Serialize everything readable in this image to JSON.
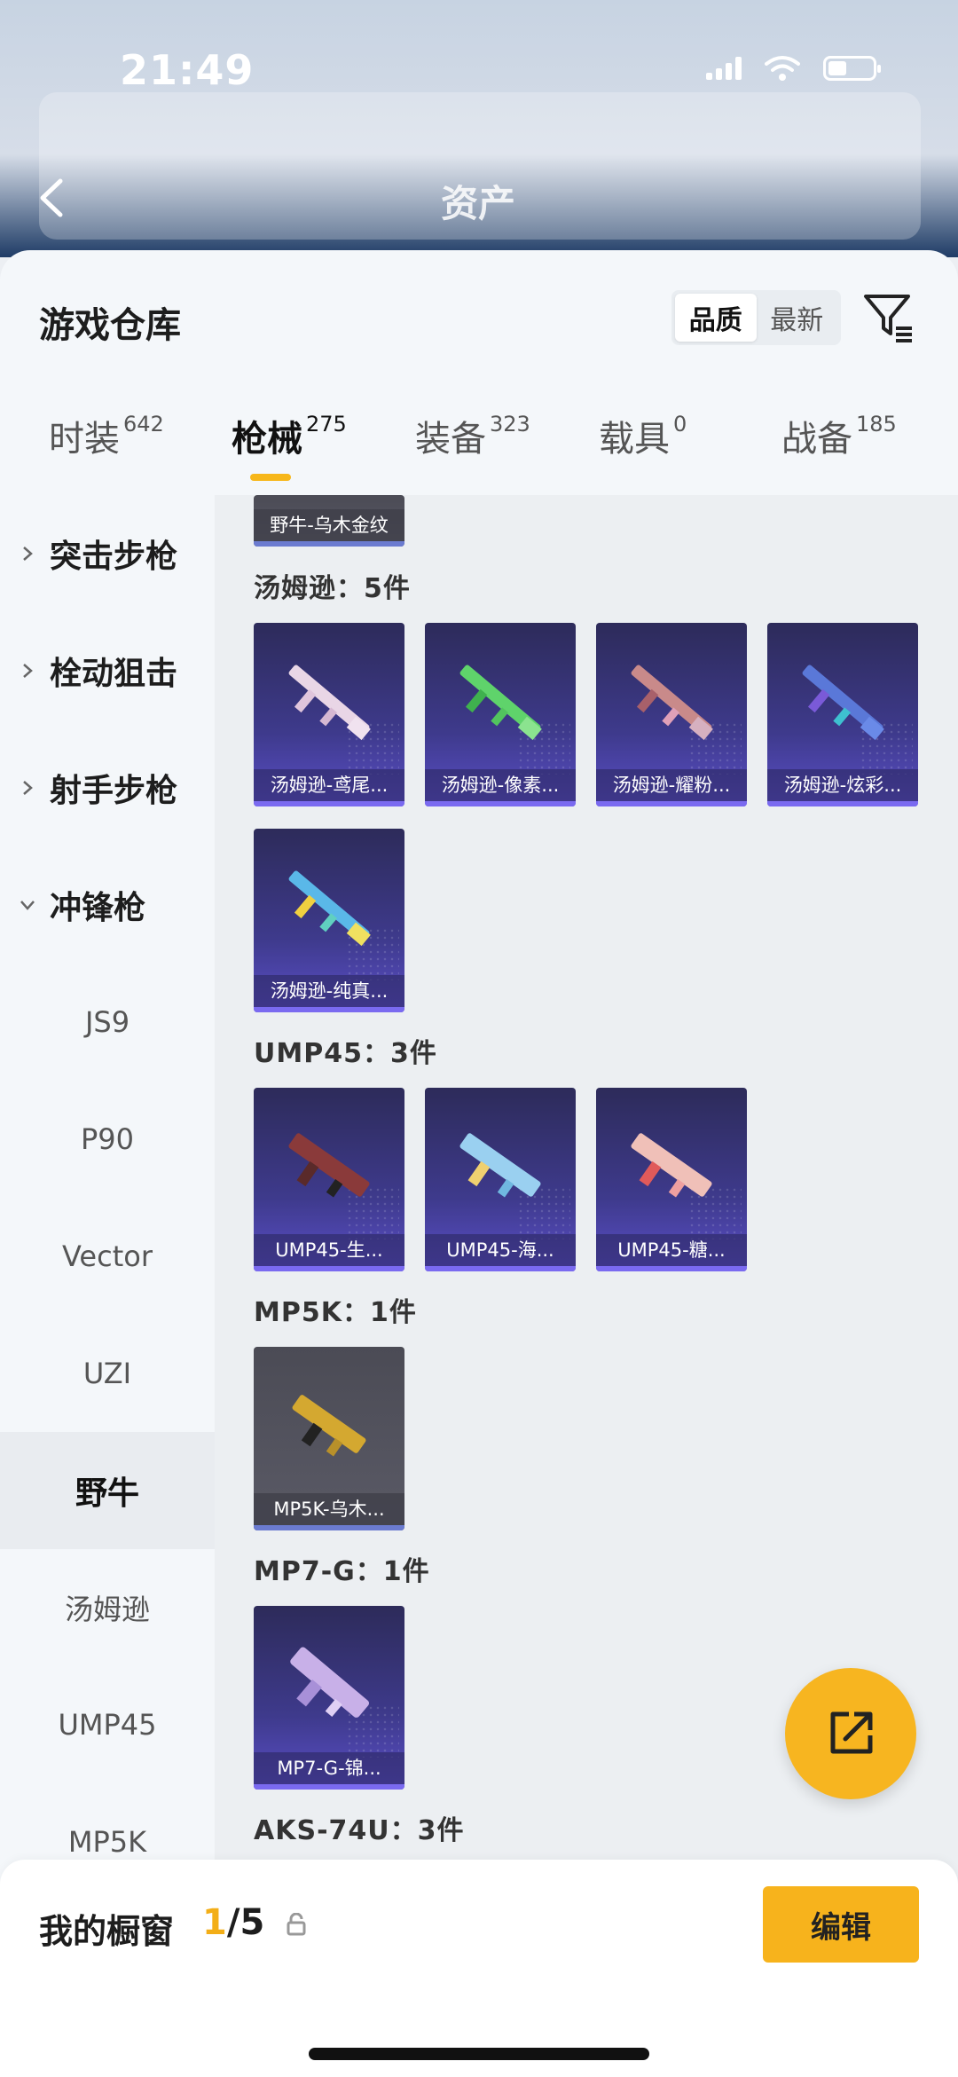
{
  "status_bar": {
    "time": "21:49"
  },
  "header": {
    "title": "资产"
  },
  "sheet": {
    "title": "游戏仓库",
    "sort": {
      "options": [
        "品质",
        "最新"
      ],
      "selected": "品质"
    }
  },
  "tabs": [
    {
      "label": "时装",
      "count": "642",
      "active": false
    },
    {
      "label": "枪械",
      "count": "275",
      "active": true
    },
    {
      "label": "装备",
      "count": "323",
      "active": false
    },
    {
      "label": "载具",
      "count": "0",
      "active": false
    },
    {
      "label": "战备",
      "count": "185",
      "active": false
    }
  ],
  "sidebar": {
    "categories": [
      {
        "label": "突击步枪",
        "expanded": false
      },
      {
        "label": "栓动狙击",
        "expanded": false
      },
      {
        "label": "射手步枪",
        "expanded": false
      },
      {
        "label": "冲锋枪",
        "expanded": true
      }
    ],
    "subcategories": [
      "JS9",
      "P90",
      "Vector",
      "UZI",
      "野牛",
      "汤姆逊",
      "UMP45",
      "MP5K"
    ],
    "selected": "野牛"
  },
  "content": {
    "partial_item": "野牛-乌木金纹",
    "groups": [
      {
        "title": "汤姆逊：5件",
        "items": [
          "汤姆逊-鸢尾...",
          "汤姆逊-像素...",
          "汤姆逊-耀粉...",
          "汤姆逊-炫彩...",
          "汤姆逊-纯真..."
        ]
      },
      {
        "title": "UMP45：3件",
        "items": [
          "UMP45-生...",
          "UMP45-海...",
          "UMP45-糖..."
        ]
      },
      {
        "title": "MP5K：1件",
        "items": [
          "MP5K-乌木..."
        ]
      },
      {
        "title": "MP7-G：1件",
        "items": [
          "MP7-G-锦..."
        ]
      },
      {
        "title": "AKS-74U：3件",
        "items": []
      }
    ]
  },
  "bottom_bar": {
    "label": "我的橱窗",
    "current": "1",
    "total": "/5",
    "edit_label": "编辑"
  },
  "colors": {
    "accent": "#f7b31c",
    "card_purple": "#3e3a8c"
  },
  "icons": [
    "back-chevron-icon",
    "filter-icon",
    "share-icon",
    "lock-icon",
    "chevron-right-icon",
    "chevron-down-icon"
  ]
}
